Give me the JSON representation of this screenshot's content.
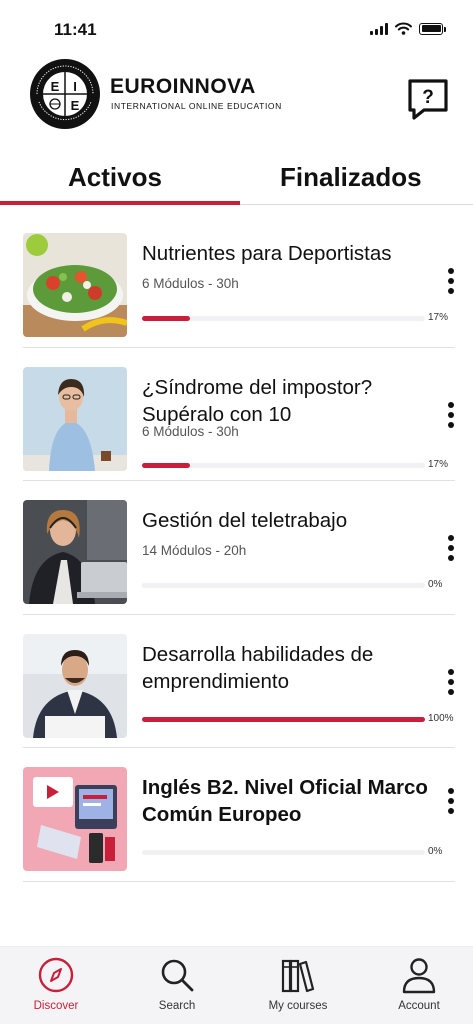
{
  "status_bar": {
    "time": "11:41",
    "icons": [
      "signal-icon",
      "wifi-icon",
      "battery-icon"
    ]
  },
  "header": {
    "brand_name": "EUROINNOVA",
    "brand_subtitle": "INTERNATIONAL ONLINE EDUCATION",
    "logo_seal_text": "EUROINNOVA INTERNATIONAL ONLINE EDUCATION",
    "logo_letters": [
      "E",
      "I",
      "E"
    ],
    "help_icon": "chat-question-icon"
  },
  "tabs": [
    {
      "label": "Activos",
      "active": true
    },
    {
      "label": "Finalizados",
      "active": false
    }
  ],
  "courses": [
    {
      "title_lines": [
        "Nutrientes para Deportistas"
      ],
      "meta": "6 Módulos - 30h",
      "progress": 0.17,
      "progress_label": "17%",
      "thumbnail": "salad-bowl-image"
    },
    {
      "title_lines": [
        "¿Síndrome del impostor?",
        "Supéralo con 10"
      ],
      "meta": "6 Módulos - 30h",
      "progress": 0.17,
      "progress_label": "17%",
      "thumbnail": "smiling-woman-image"
    },
    {
      "title_lines": [
        "Gestión del teletrabajo"
      ],
      "meta": "14 Módulos - 20h",
      "progress": 0.0,
      "progress_label": "0%",
      "thumbnail": "headset-woman-laptop-image"
    },
    {
      "title_lines": [
        "Desarrolla habilidades de",
        "emprendimiento"
      ],
      "meta": "",
      "progress": 1.0,
      "progress_label": "100%",
      "thumbnail": "businessman-image"
    },
    {
      "title_lines": [
        "Inglés B2. Nivel Oficial Marco",
        "Común Europeo"
      ],
      "meta": "",
      "progress": 0.0,
      "progress_label": "0%",
      "thumbnail": "online-learning-illustration"
    }
  ],
  "bottom_nav": [
    {
      "label": "Discover",
      "icon": "compass-icon",
      "active": true
    },
    {
      "label": "Search",
      "icon": "search-icon",
      "active": false
    },
    {
      "label": "My courses",
      "icon": "books-icon",
      "active": false
    },
    {
      "label": "Account",
      "icon": "user-icon",
      "active": false
    }
  ],
  "colors": {
    "accent": "#c8203a",
    "track": "#f1f1f3",
    "nav_background": "#f4f4f6"
  }
}
